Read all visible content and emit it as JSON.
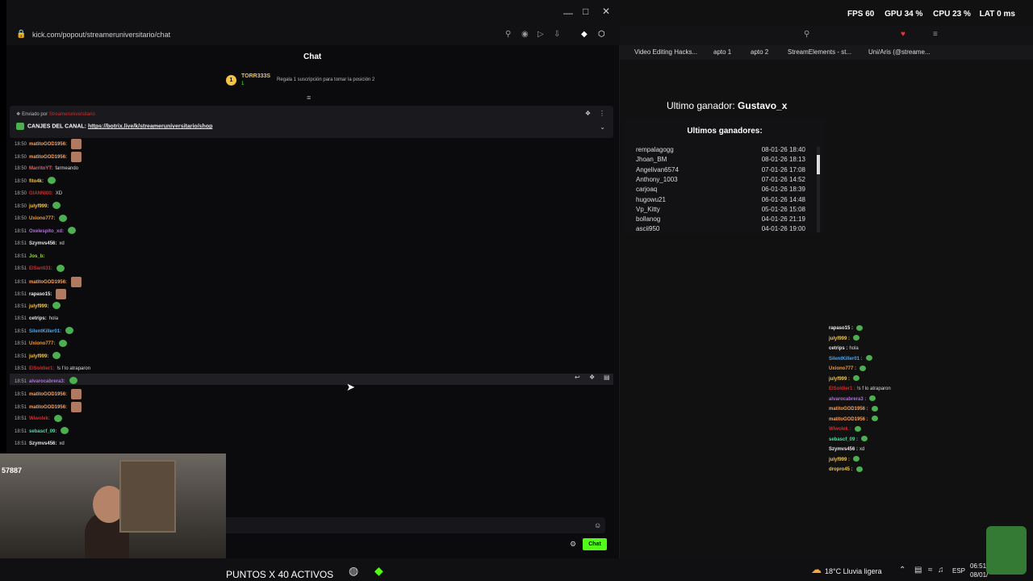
{
  "browser": {
    "url": "kick.com/popout/streameruniversitario/chat"
  },
  "chat": {
    "title": "Chat",
    "top_gifter": {
      "rank": "1",
      "name": "TORR333S",
      "count": "1",
      "cta": "Regala 1 suscripción para tomar la posición 2"
    },
    "pinned": {
      "sent_by_label": "Enviado por",
      "sender": "Streameruniversitario",
      "text": "CANJES DEL CANAL: ",
      "link": "https://botrix.live/k/streameruniversitario/shop"
    },
    "messages": [
      {
        "time": "18:50",
        "user": "matitoGOD1956:",
        "text": "",
        "emote": "face",
        "color": "#f7a35a"
      },
      {
        "time": "18:50",
        "user": "matitoGOD1956:",
        "text": "",
        "emote": "face",
        "color": "#f7a35a"
      },
      {
        "time": "18:50",
        "user": "MarritoYT:",
        "text": "farmeando",
        "emote": "",
        "color": "#e85a72"
      },
      {
        "time": "18:50",
        "user": "fito4k:",
        "text": "",
        "emote": "green",
        "color": "#f4c542"
      },
      {
        "time": "18:50",
        "user": "GIANNI00:",
        "text": "XD",
        "emote": "",
        "color": "#d12c2c"
      },
      {
        "time": "18:50",
        "user": "julyf999:",
        "text": "",
        "emote": "green",
        "color": "#f4c542"
      },
      {
        "time": "18:50",
        "user": "Uxiono777:",
        "text": "",
        "emote": "green",
        "color": "#f59a2e"
      },
      {
        "time": "18:51",
        "user": "Oxelespito_xd:",
        "text": "",
        "emote": "green",
        "color": "#b36ee0"
      },
      {
        "time": "18:51",
        "user": "Szymvs456:",
        "text": "xd",
        "emote": "",
        "color": "#e8e8e8"
      },
      {
        "time": "18:51",
        "user": "Jos_b:",
        "text": "",
        "emote": "",
        "color": "#9fd44a"
      },
      {
        "time": "18:51",
        "user": "ElSanti31:",
        "text": "",
        "emote": "green",
        "color": "#d12c2c"
      },
      {
        "time": "18:51",
        "user": "matitoGOD1956:",
        "text": "",
        "emote": "face",
        "color": "#f7a35a"
      },
      {
        "time": "18:51",
        "user": "rapaso15:",
        "text": "",
        "emote": "face",
        "color": "#f0f0f0"
      },
      {
        "time": "18:51",
        "user": "julyf999:",
        "text": "",
        "emote": "green",
        "color": "#f4c542"
      },
      {
        "time": "18:51",
        "user": "cetrips:",
        "text": "hola",
        "emote": "",
        "color": "#e8e8e8"
      },
      {
        "time": "18:51",
        "user": "SilentKiller01:",
        "text": "",
        "emote": "green",
        "color": "#4aa8f0"
      },
      {
        "time": "18:51",
        "user": "Uxiono777:",
        "text": "",
        "emote": "green",
        "color": "#f59a2e"
      },
      {
        "time": "18:51",
        "user": "julyf999:",
        "text": "",
        "emote": "green",
        "color": "#f4c542"
      },
      {
        "time": "18:51",
        "user": "ElSoldier1:",
        "text": "!s f lo atraparon",
        "emote": "",
        "color": "#d12c2c"
      },
      {
        "time": "18:51",
        "user": "alvarocabrera3:",
        "text": "",
        "emote": "green",
        "color": "#b36ee0"
      },
      {
        "time": "18:51",
        "user": "matitoGOD1956:",
        "text": "",
        "emote": "face",
        "color": "#f7a35a"
      },
      {
        "time": "18:51",
        "user": "matitoGOD1956:",
        "text": "",
        "emote": "face",
        "color": "#f7a35a"
      },
      {
        "time": "18:51",
        "user": "Wiwolek:",
        "text": "",
        "emote": "green",
        "color": "#d12c2c"
      },
      {
        "time": "18:51",
        "user": "sebascf_09:",
        "text": "",
        "emote": "green",
        "color": "#4ae0a0"
      },
      {
        "time": "18:51",
        "user": "Szymvs456:",
        "text": "xd",
        "emote": "",
        "color": "#e8e8e8"
      }
    ],
    "send_label": "Chat"
  },
  "overlay": {
    "hud": {
      "fps_label": "FPS",
      "fps": "60",
      "gpu_label": "GPU",
      "gpu": "34 %",
      "cpu_label": "CPU",
      "cpu": "23 %",
      "lat_label": "LAT",
      "lat": "0 ms"
    },
    "bookmarks": [
      "Video Editing Hacks...",
      "apto 1",
      "apto 2",
      "StreamElements - st...",
      "Uni/Aris (@streame..."
    ],
    "last_winner_label": "Ultimo ganador: ",
    "last_winner": "Gustavo_x",
    "winners_title": "Ultimos ganadores:",
    "winners": [
      {
        "name": "rempalagogg",
        "date": "08-01-26 18:40"
      },
      {
        "name": "Jhoan_BM",
        "date": "08-01-26 18:13"
      },
      {
        "name": "Angelivan6574",
        "date": "07-01-26 17:08"
      },
      {
        "name": "Anthony_1003",
        "date": "07-01-26 14:52"
      },
      {
        "name": "carjoaq",
        "date": "06-01-26 18:39"
      },
      {
        "name": "hugowu21",
        "date": "06-01-26 14:48"
      },
      {
        "name": "Vp_Kitty",
        "date": "05-01-26 15:08"
      },
      {
        "name": "bollanog",
        "date": "04-01-26 21:19"
      },
      {
        "name": "ascii950",
        "date": "04-01-26 19:00"
      }
    ],
    "mini_chat": [
      {
        "user": "rapaso15 :",
        "text": "",
        "color": "#f0f0f0"
      },
      {
        "user": "julyf999 :",
        "text": "",
        "color": "#f4c542"
      },
      {
        "user": "cetrips :",
        "text": "hola",
        "color": "#e8e8e8"
      },
      {
        "user": "SilentKiller01 :",
        "text": "",
        "color": "#4aa8f0"
      },
      {
        "user": "Uxiono777 :",
        "text": "",
        "color": "#f59a2e"
      },
      {
        "user": "julyf999 :",
        "text": "",
        "color": "#f4c542"
      },
      {
        "user": "ElSoldier1 :",
        "text": "!s f lo atraparon",
        "color": "#d12c2c"
      },
      {
        "user": "alvarocabrera3 :",
        "text": "",
        "color": "#b36ee0"
      },
      {
        "user": "matitoGOD1956 :",
        "text": "",
        "color": "#f7a35a"
      },
      {
        "user": "matitoGOD1956 :",
        "text": "",
        "color": "#f7a35a"
      },
      {
        "user": "Wiwolek :",
        "text": "",
        "color": "#d12c2c"
      },
      {
        "user": "sebascf_09 :",
        "text": "",
        "color": "#4ae0a0"
      },
      {
        "user": "Szymvs456 :",
        "text": "xd",
        "color": "#e8e8e8"
      },
      {
        "user": "julyf999 :",
        "text": "",
        "color": "#f4c542"
      },
      {
        "user": "dropro45 :",
        "text": "",
        "color": "#f4c542"
      }
    ],
    "webcam_label": "57887",
    "banner": "PUNTOS X 40 ACTIVOS",
    "weather": "18°C  Lluvia ligera",
    "lang": "ESP",
    "clock_time": "06:51",
    "clock_date": "08/01/"
  }
}
